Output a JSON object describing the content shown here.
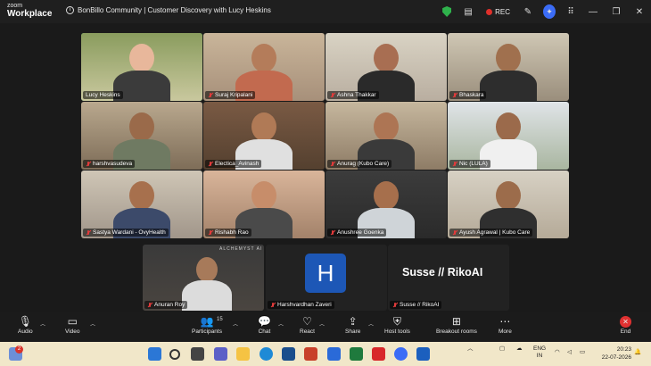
{
  "app": {
    "logo_line1": "zoom",
    "logo_line2": "Workplace"
  },
  "meeting": {
    "title": "BonBillo Community | Customer Discovery with Lucy Heskins",
    "rec_label": "REC"
  },
  "participants": [
    {
      "name": "Lucy Heskins",
      "muted": false,
      "active": true
    },
    {
      "name": "Suraj Kripalani",
      "muted": true
    },
    {
      "name": "Ashna Thakkar",
      "muted": true
    },
    {
      "name": "Bhaskara",
      "muted": true
    },
    {
      "name": "harshvasudeva",
      "muted": true
    },
    {
      "name": "Electica_Avinash",
      "muted": true
    },
    {
      "name": "Anurag (Kubo Care)",
      "muted": true
    },
    {
      "name": "Nic (LULA)",
      "muted": true
    },
    {
      "name": "Sastya Wardani - OvyHealth",
      "muted": true
    },
    {
      "name": "Rishabh Rao",
      "muted": true
    },
    {
      "name": "Anushree Goenka",
      "muted": true
    },
    {
      "name": "Ayush Agrawal | Kubo Care",
      "muted": true
    }
  ],
  "bottom_row": {
    "anuran": {
      "name": "Anuran Roy",
      "overlay": "ALCHEMYST AI"
    },
    "harsh": {
      "name": "Harshvardhan Zaveri",
      "avatar_letter": "H"
    },
    "susse": {
      "name": "Susse // RikoAI",
      "display": "Susse // RikoAI"
    }
  },
  "toolbar": {
    "audio": "Audio",
    "video": "Video",
    "participants": "Participants",
    "participants_count": "15",
    "chat": "Chat",
    "react": "React",
    "share": "Share",
    "host_tools": "Host tools",
    "breakout": "Breakout rooms",
    "more": "More",
    "end": "End"
  },
  "taskbar": {
    "notif_count": "2",
    "lang_1": "ENG",
    "lang_2": "IN",
    "time": "20:23",
    "date": "22-07-2026"
  },
  "colors": {
    "active_border": "#3ed47a",
    "end_red": "#e03131",
    "rec_red": "#e0302b",
    "avatar_blue": "#1d57b6"
  }
}
